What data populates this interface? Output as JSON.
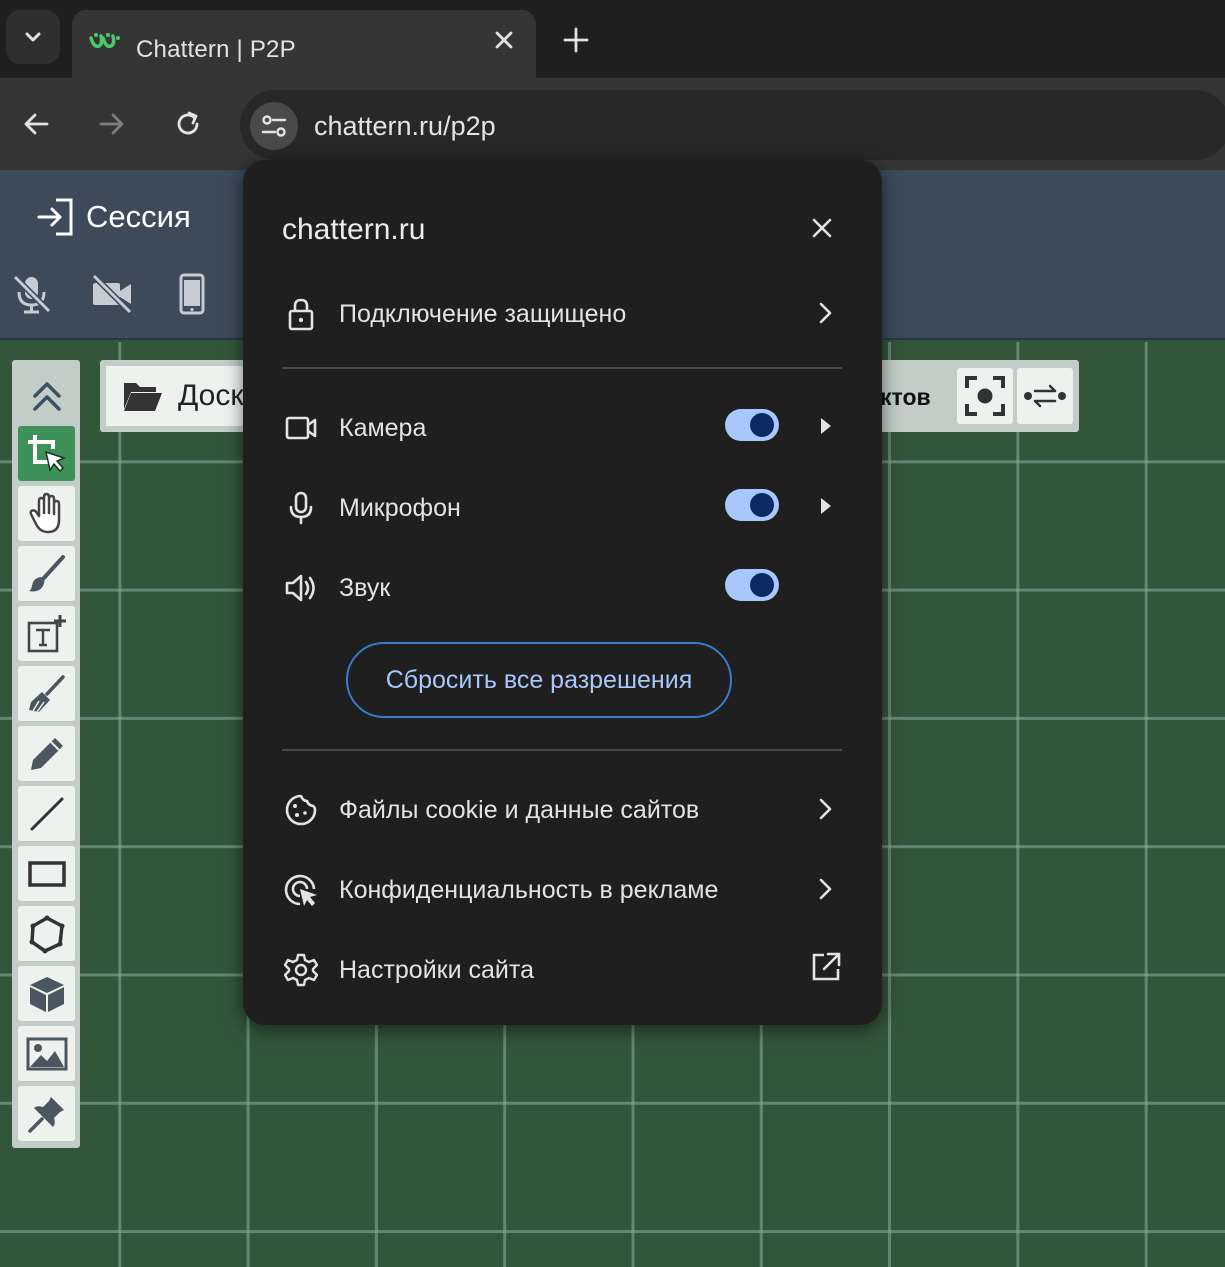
{
  "browser": {
    "tab_title": "Chattern | P2P",
    "url": "chattern.ru/p2p"
  },
  "app": {
    "session_label": "Сессия",
    "boards_label": "Доск",
    "objects_label": "ктов"
  },
  "popup": {
    "site": "chattern.ru",
    "connection": "Подключение защищено",
    "permissions": [
      {
        "label": "Камера",
        "enabled": true
      },
      {
        "label": "Микрофон",
        "enabled": true
      },
      {
        "label": "Звук",
        "enabled": true
      }
    ],
    "reset_label": "Сбросить все разрешения",
    "links": [
      {
        "label": "Файлы cookie и данные сайтов"
      },
      {
        "label": "Конфиденциальность в рекламе"
      },
      {
        "label": "Настройки сайта"
      }
    ]
  },
  "colors": {
    "canvas_bg": "#33553a",
    "header_bg": "#3c4a5a",
    "active_tool": "#3d9159",
    "toggle_on": "#a8c7fa",
    "popup_bg": "#1f1f1f"
  },
  "tools": [
    "collapse-icon",
    "select-icon",
    "hand-icon",
    "brush-icon",
    "text-icon",
    "eraser-icon",
    "pencil-icon",
    "line-icon",
    "rectangle-icon",
    "polygon-icon",
    "cube-icon",
    "image-icon",
    "pin-icon"
  ]
}
